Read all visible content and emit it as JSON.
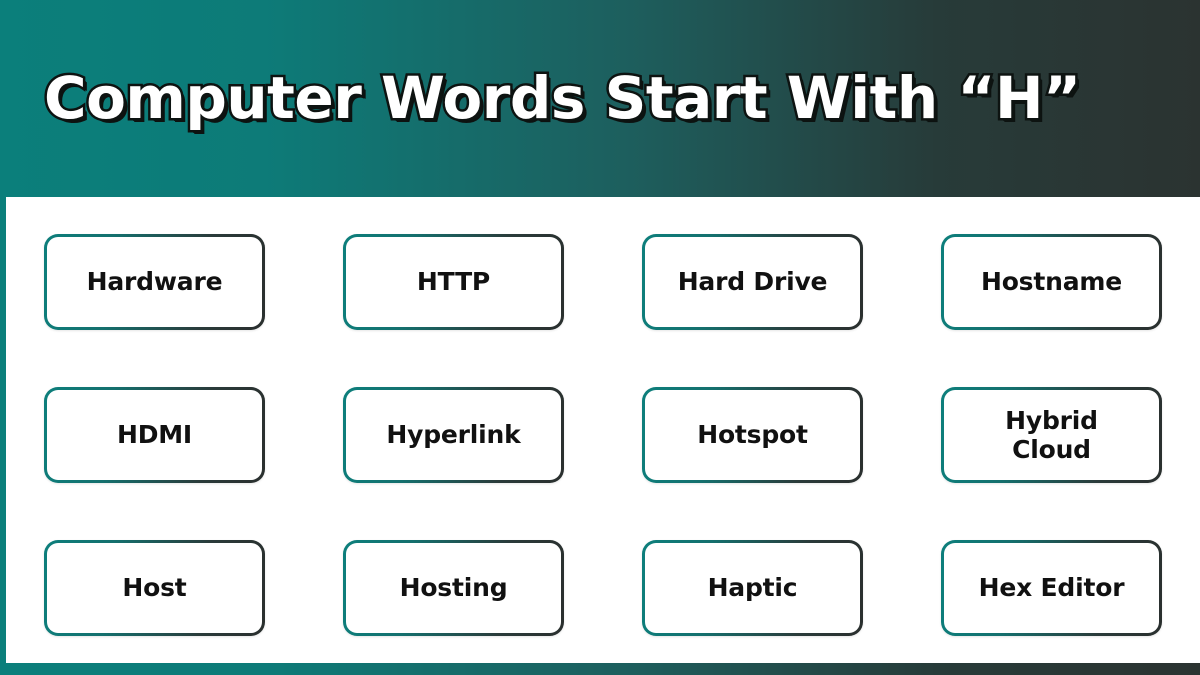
{
  "header": {
    "title": "Computer Words Start With “H”",
    "gradient_start": "#0d7f7c",
    "gradient_end": "#2b3331",
    "title_color": "#ffffff",
    "title_outline_color": "#0d1311"
  },
  "panel": {
    "background": "#ffffff"
  },
  "card_style": {
    "border_gradient_start": "#0d7f7c",
    "border_gradient_end": "#2a2f2e",
    "label_color": "#111111",
    "background": "#ffffff"
  },
  "cards": [
    {
      "label": "Hardware"
    },
    {
      "label": "HTTP"
    },
    {
      "label": "Hard Drive"
    },
    {
      "label": "Hostname"
    },
    {
      "label": "HDMI"
    },
    {
      "label": "Hyperlink"
    },
    {
      "label": "Hotspot"
    },
    {
      "label": "Hybrid\nCloud"
    },
    {
      "label": "Host"
    },
    {
      "label": "Hosting"
    },
    {
      "label": "Haptic"
    },
    {
      "label": "Hex Editor"
    }
  ]
}
